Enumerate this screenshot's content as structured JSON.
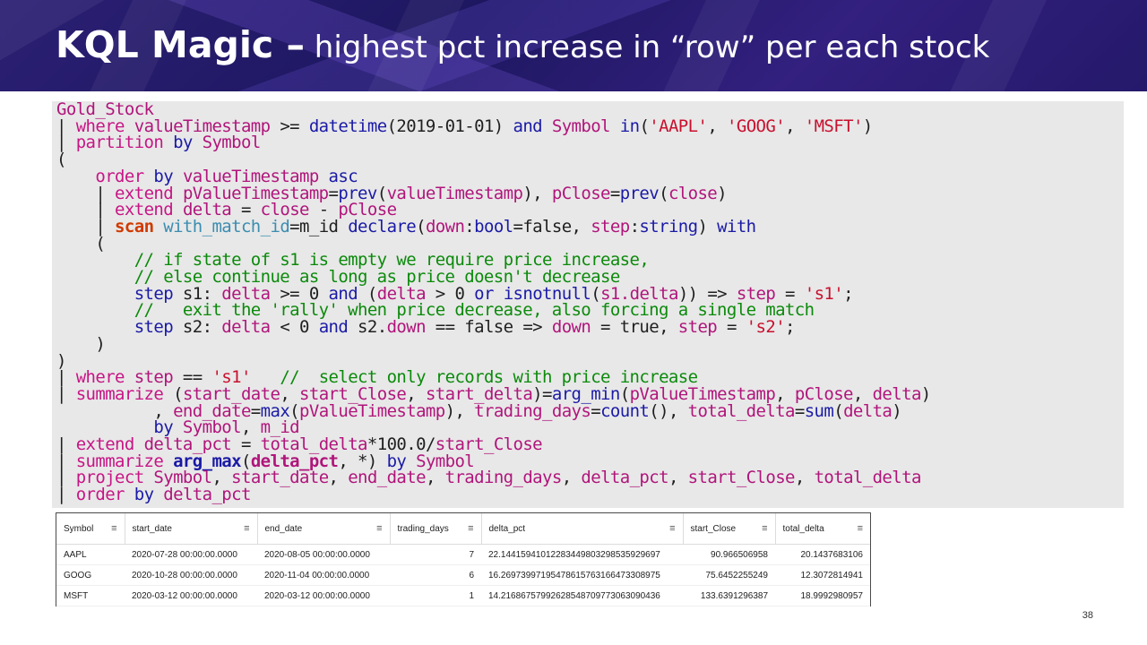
{
  "slide": {
    "title_bold": "KQL Magic –",
    "title_rest": " highest pct increase in “row” per each stock",
    "page_number": "38"
  },
  "code": {
    "lines": [
      "Gold_Stock",
      "| where valueTimestamp >= datetime(2019-01-01) and Symbol in('AAPL', 'GOOG', 'MSFT')",
      "| partition by Symbol",
      "(",
      "    order by valueTimestamp asc",
      "    | extend pValueTimestamp=prev(valueTimestamp), pClose=prev(close)",
      "    | extend delta = close - pClose",
      "    | scan with_match_id=m_id declare(down:bool=false, step:string) with",
      "    (",
      "        // if state of s1 is empty we require price increase,",
      "        // else continue as long as price doesn't decrease",
      "        step s1: delta >= 0 and (delta > 0 or isnotnull(s1.delta)) => step = 's1';",
      "        //   exit the 'rally' when price decrease, also forcing a single match",
      "        step s2: delta < 0 and s2.down == false => down = true, step = 's2';",
      "    )",
      ")",
      "| where step == 's1'   //  select only records with price increase",
      "| summarize (start_date, start_Close, start_delta)=arg_min(pValueTimestamp, pClose, delta)",
      "          , end_date=max(pValueTimestamp), trading_days=count(), total_delta=sum(delta)",
      "          by Symbol, m_id",
      "| extend delta_pct = total_delta*100.0/start_Close",
      "| summarize arg_max(delta_pct, *) by Symbol",
      "| project Symbol, start_date, end_date, trading_days, delta_pct, start_Close, total_delta",
      "| order by delta_pct"
    ]
  },
  "results": {
    "columns": [
      "Symbol",
      "start_date",
      "end_date",
      "trading_days",
      "delta_pct",
      "start_Close",
      "total_delta"
    ],
    "menu_icon": "≡",
    "rows": [
      [
        "AAPL",
        "2020-07-28 00:00:00.0000",
        "2020-08-05 00:00:00.0000",
        "7",
        "22.144159410122834498032985359296​97",
        "90.966506958",
        "20.1437683106"
      ],
      [
        "GOOG",
        "2020-10-28 00:00:00.0000",
        "2020-11-04 00:00:00.0000",
        "6",
        "16.269739971954786157631664733089​75",
        "75.6452255249",
        "12.3072814941"
      ],
      [
        "MSFT",
        "2020-03-12 00:00:00.0000",
        "2020-03-12 00:00:00.0000",
        "1",
        "14.216867579926285487097730630904​36",
        "133.6391296387",
        "18.9992980957"
      ]
    ]
  }
}
